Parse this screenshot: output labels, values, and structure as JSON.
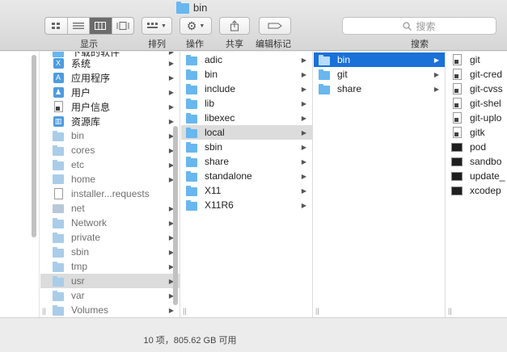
{
  "window": {
    "title": "bin"
  },
  "toolbar": {
    "view_label": "显示",
    "arrange_label": "排列",
    "action_label": "操作",
    "share_label": "共享",
    "tags_label": "编辑标记",
    "search_placeholder": "搜索",
    "search_label": "搜索"
  },
  "columns": {
    "col1": {
      "items": [
        {
          "label": "下载的软件",
          "icon": "folder-icon"
        },
        {
          "label": "系统",
          "icon": "system-folder-icon"
        },
        {
          "label": "应用程序",
          "icon": "applications-folder-icon"
        },
        {
          "label": "用户",
          "icon": "users-folder-icon"
        },
        {
          "label": "用户信息",
          "icon": "document-icon"
        },
        {
          "label": "资源库",
          "icon": "library-folder-icon"
        },
        {
          "label": "bin",
          "icon": "folder-icon"
        },
        {
          "label": "cores",
          "icon": "folder-icon"
        },
        {
          "label": "etc",
          "icon": "alias-folder-icon"
        },
        {
          "label": "home",
          "icon": "home-folder-icon"
        },
        {
          "label": "installer...requests",
          "icon": "document-icon"
        },
        {
          "label": "net",
          "icon": "network-folder-icon"
        },
        {
          "label": "Network",
          "icon": "folder-icon"
        },
        {
          "label": "private",
          "icon": "folder-icon"
        },
        {
          "label": "sbin",
          "icon": "folder-icon"
        },
        {
          "label": "tmp",
          "icon": "alias-folder-icon"
        },
        {
          "label": "usr",
          "icon": "folder-icon"
        },
        {
          "label": "var",
          "icon": "alias-folder-icon"
        },
        {
          "label": "Volumes",
          "icon": "folder-icon"
        }
      ]
    },
    "col2": {
      "items": [
        {
          "label": "adic"
        },
        {
          "label": "bin"
        },
        {
          "label": "include"
        },
        {
          "label": "lib"
        },
        {
          "label": "libexec"
        },
        {
          "label": "local"
        },
        {
          "label": "sbin"
        },
        {
          "label": "share"
        },
        {
          "label": "standalone"
        },
        {
          "label": "X11"
        },
        {
          "label": "X11R6"
        }
      ]
    },
    "col3": {
      "items": [
        {
          "label": "bin"
        },
        {
          "label": "git"
        },
        {
          "label": "share"
        }
      ]
    },
    "col4": {
      "items": [
        {
          "label": "git",
          "icon": "document-icon"
        },
        {
          "label": "git-cred",
          "icon": "document-icon"
        },
        {
          "label": "git-cvss",
          "icon": "document-icon"
        },
        {
          "label": "git-shel",
          "icon": "document-icon"
        },
        {
          "label": "git-uplo",
          "icon": "document-icon"
        },
        {
          "label": "gitk",
          "icon": "document-icon"
        },
        {
          "label": "pod",
          "icon": "terminal-icon"
        },
        {
          "label": "sandbo",
          "icon": "terminal-icon"
        },
        {
          "label": "update_",
          "icon": "terminal-icon"
        },
        {
          "label": "xcodep",
          "icon": "terminal-icon"
        }
      ]
    }
  },
  "status": {
    "text": "10 项，805.62 GB 可用"
  }
}
